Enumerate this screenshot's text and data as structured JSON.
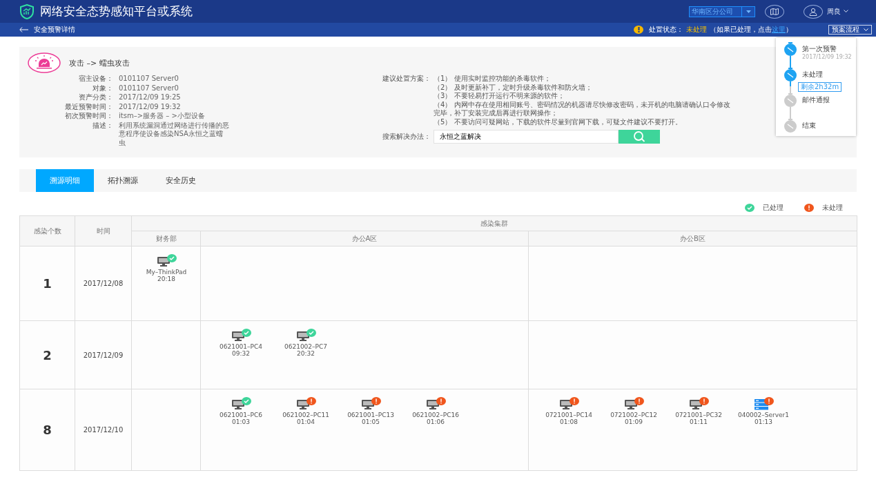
{
  "header": {
    "title": "网络安全态势感知平台或系统",
    "branch": "华南区分公司",
    "user": "周良"
  },
  "subbar": {
    "page_title": "安全预警详情",
    "status_label": "处置状态：",
    "status_value": "未处理",
    "hint_before": "（如果已处理，点击",
    "hint_link": "这里",
    "hint_after": "）",
    "plan_button": "预案流程"
  },
  "plan_steps": [
    {
      "label": "第一次预警",
      "time": "2017/12/09 19:32",
      "active": true
    },
    {
      "label": "未处理",
      "active": true,
      "remaining": "剩余2h32m"
    },
    {
      "label": "邮件通报",
      "active": false
    },
    {
      "label": "结束",
      "active": false
    }
  ],
  "alert": {
    "title": "攻击 –> 蠕虫攻击",
    "fields": [
      {
        "label": "宿主设备：",
        "value": "0101107 Server0"
      },
      {
        "label": "对象：",
        "value": "0101107 Server0"
      },
      {
        "label": "资产分类：",
        "value": "2017/12/09 19:25"
      },
      {
        "label": "最近预警时间：",
        "value": "2017/12/09 19:32"
      },
      {
        "label": "初次预警时间：",
        "value": "itsm–>服务器 – >小型设备"
      },
      {
        "label": "描述：",
        "value": "利用系统漏洞通过网络进行传播的恶意程序使设备感染NSA永恒之蓝蠕虫"
      }
    ],
    "suggestion_label": "建议处置方案：",
    "suggestions": [
      "（1） 使用实时监控功能的杀毒软件；",
      "（2） 及时更新补丁，定时升级杀毒软件和防火墙；",
      "（3） 不要轻易打开运行不明来源的软件；",
      "（4） 内网中存在使用相同账号、密码情况的机器请尽快修改密码，未开机的电脑请确认口令修改完毕，补丁安装完成后再进行联网操作；",
      "（5） 不要访问可疑网站，下载的软件尽量到官网下载，可疑文件建议不要打开。"
    ],
    "search_label": "搜索解决办法：",
    "search_value": "永恒之蓝解决"
  },
  "tabs": [
    {
      "label": "溯源明细",
      "selected": true
    },
    {
      "label": "拓扑溯源",
      "selected": false
    },
    {
      "label": "安全历史",
      "selected": false
    }
  ],
  "legend": [
    {
      "label": "已处理",
      "handled": true
    },
    {
      "label": "未处理",
      "handled": false
    }
  ],
  "table": {
    "col_count": "感染个数",
    "col_time": "时间",
    "col_cluster": "感染集群",
    "groups": [
      "财务部",
      "办公A区",
      "办公B区"
    ],
    "rows": [
      {
        "count": "1",
        "date": "2017/12/08",
        "cells": [
          [
            {
              "name": "My–ThinkPad",
              "time": "20:18",
              "kind": "pc",
              "handled": true
            }
          ],
          [],
          []
        ]
      },
      {
        "count": "2",
        "date": "2017/12/09",
        "cells": [
          [],
          [
            {
              "name": "0621001–PC4",
              "time": "09:32",
              "kind": "pc",
              "handled": true
            },
            {
              "name": "0621002–PC7",
              "time": "20:32",
              "kind": "pc",
              "handled": true
            }
          ],
          []
        ]
      },
      {
        "count": "8",
        "date": "2017/12/10",
        "cells": [
          [],
          [
            {
              "name": "0621001–PC6",
              "time": "01:03",
              "kind": "pc",
              "handled": true
            },
            {
              "name": "0621002–PC11",
              "time": "01:04",
              "kind": "pc",
              "handled": false
            },
            {
              "name": "0621001–PC13",
              "time": "01:05",
              "kind": "pc",
              "handled": false
            },
            {
              "name": "0621002–PC16",
              "time": "01:06",
              "kind": "pc",
              "handled": false
            }
          ],
          [
            {
              "name": "0721001–PC14",
              "time": "01:08",
              "kind": "pc",
              "handled": false
            },
            {
              "name": "0721002–PC12",
              "time": "01:09",
              "kind": "pc",
              "handled": false
            },
            {
              "name": "0721001–PC32",
              "time": "01:11",
              "kind": "pc",
              "handled": false
            },
            {
              "name": "040002–Server1",
              "time": "01:13",
              "kind": "server",
              "handled": false
            }
          ]
        ]
      }
    ]
  }
}
